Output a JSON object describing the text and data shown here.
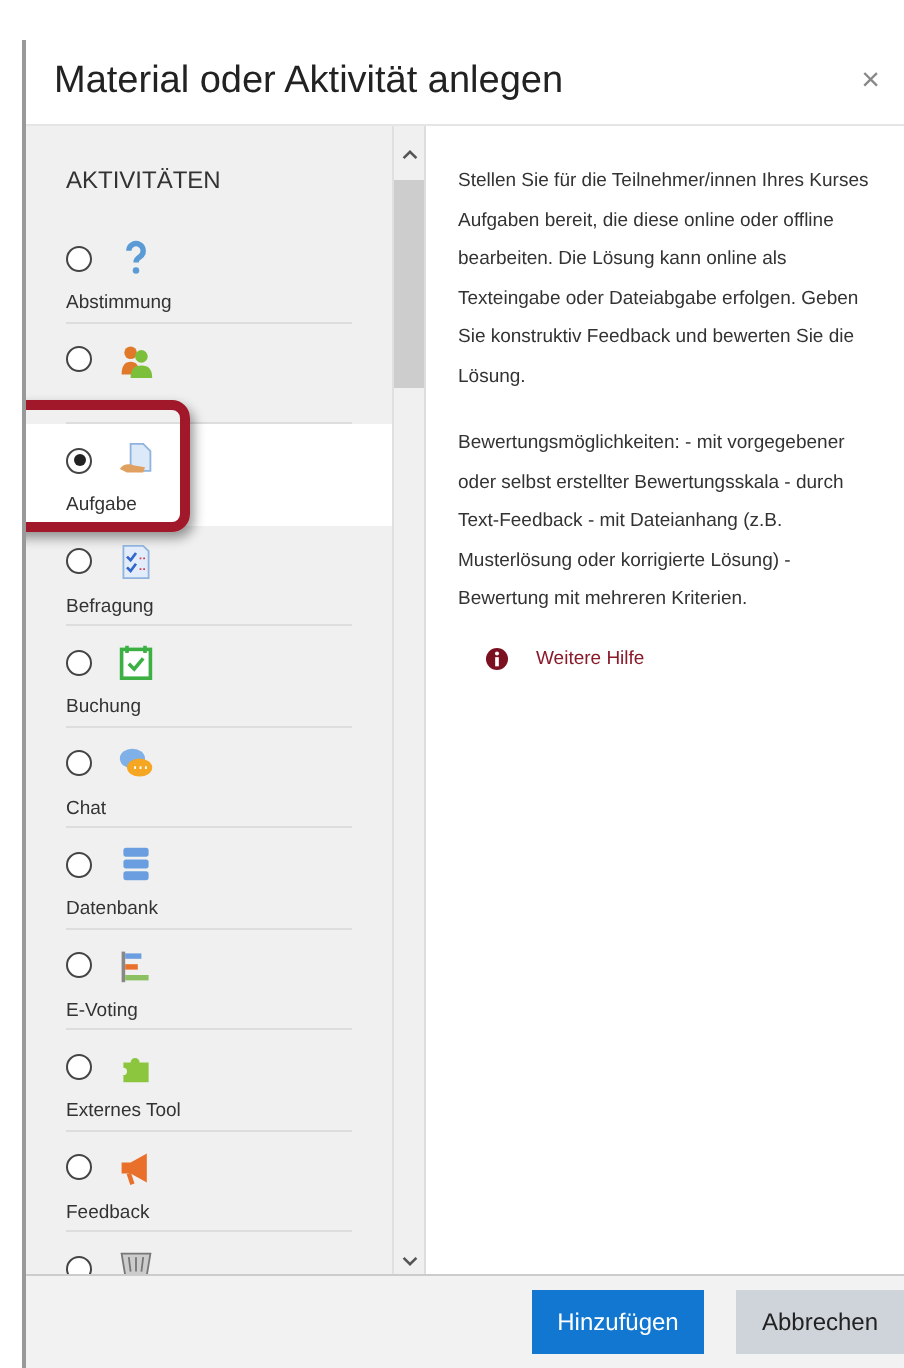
{
  "dialog": {
    "title": "Material oder Aktivität anlegen",
    "close": "×"
  },
  "section_heading": "AKTIVITÄTEN",
  "items": [
    {
      "label": "Abstimmung",
      "selected": false
    },
    {
      "selected": false
    },
    {
      "label": "Aufgabe",
      "selected": true,
      "highlighted": true
    },
    {
      "label": "Befragung",
      "selected": false
    },
    {
      "label": "Buchung",
      "selected": false
    },
    {
      "label": "Chat",
      "selected": false
    },
    {
      "label": "Datenbank",
      "selected": false
    },
    {
      "label": "E-Voting",
      "selected": false
    },
    {
      "label": "Externes Tool",
      "selected": false
    },
    {
      "label": "Feedback",
      "selected": false
    },
    {
      "selected": false
    }
  ],
  "description": [
    "Stellen Sie für die Teilnehmer/innen Ihres Kurses Aufgaben bereit, die diese online oder offline bearbeiten. Die Lösung kann online als Texteingabe oder Dateiabgabe erfolgen. Geben Sie konstruktiv Feedback und bewerten Sie die Lösung.",
    "Bewertungsmöglichkeiten: - mit vorgegebener oder selbst erstellter Bewertungsskala - durch Text-Feedback - mit Dateianhang (z.B. Musterlösung oder korrigierte Lösung) - Bewertung mit mehreren Kriterien."
  ],
  "help_link": "Weitere Hilfe",
  "buttons": [
    {
      "label": "Hinzufügen",
      "kind": "primary"
    },
    {
      "label": "Abbrechen",
      "kind": "secondary"
    }
  ]
}
